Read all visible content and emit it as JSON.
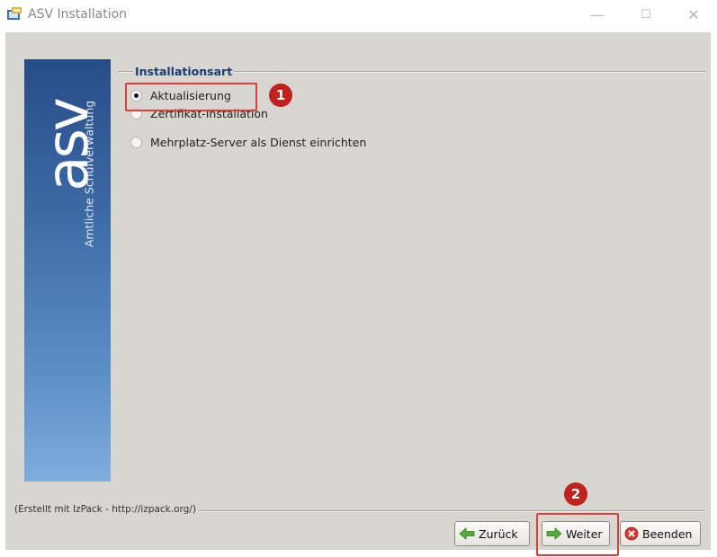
{
  "window": {
    "title": "ASV Installation",
    "controls": {
      "minimize": "—",
      "maximize": "☐",
      "close": "✕"
    }
  },
  "banner": {
    "logo": "asv",
    "subtitle": "Amtliche Schulverwaltung"
  },
  "group": {
    "title": "Installationsart",
    "options": [
      {
        "label": "Aktualisierung",
        "selected": true
      },
      {
        "label": "Zertifikat-Installation",
        "selected": false
      },
      {
        "label": "Mehrplatz-Server als Dienst einrichten",
        "selected": false
      }
    ]
  },
  "annotations": {
    "badge_1": "1",
    "badge_2": "2",
    "highlight_color": "#d9403a",
    "badge_color": "#c0221d"
  },
  "footer": {
    "credit": "(Erstellt mit IzPack - http://izpack.org/)"
  },
  "buttons": {
    "back": "Zurück",
    "next": "Weiter",
    "quit": "Beenden"
  },
  "icons": {
    "back": "green-arrow-left-icon",
    "next": "green-arrow-right-icon",
    "quit": "red-x-circle-icon"
  }
}
